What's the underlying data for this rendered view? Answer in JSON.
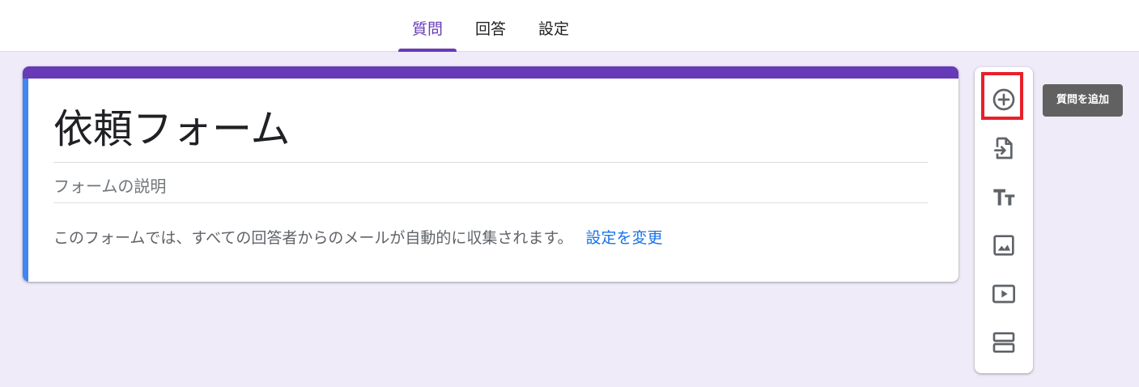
{
  "tabs": [
    {
      "label": "質問",
      "active": true
    },
    {
      "label": "回答",
      "active": false
    },
    {
      "label": "設定",
      "active": false
    }
  ],
  "form": {
    "title": "依頼フォーム",
    "description_placeholder": "フォームの説明",
    "email_notice": "このフォームでは、すべての回答者からのメールが自動的に収集されます。",
    "change_settings_link": "設定を変更"
  },
  "toolbar": {
    "items": [
      {
        "icon": "add-circle-icon"
      },
      {
        "icon": "import-questions-icon"
      },
      {
        "icon": "title-text-icon"
      },
      {
        "icon": "image-icon"
      },
      {
        "icon": "video-icon"
      },
      {
        "icon": "section-icon"
      }
    ],
    "tooltip": "質問を追加"
  },
  "colors": {
    "accent": "#673ab7",
    "background": "#f0ebf8",
    "card_left_bar": "#4285f4",
    "link": "#1a73e8",
    "highlight_box": "#e8202a"
  }
}
